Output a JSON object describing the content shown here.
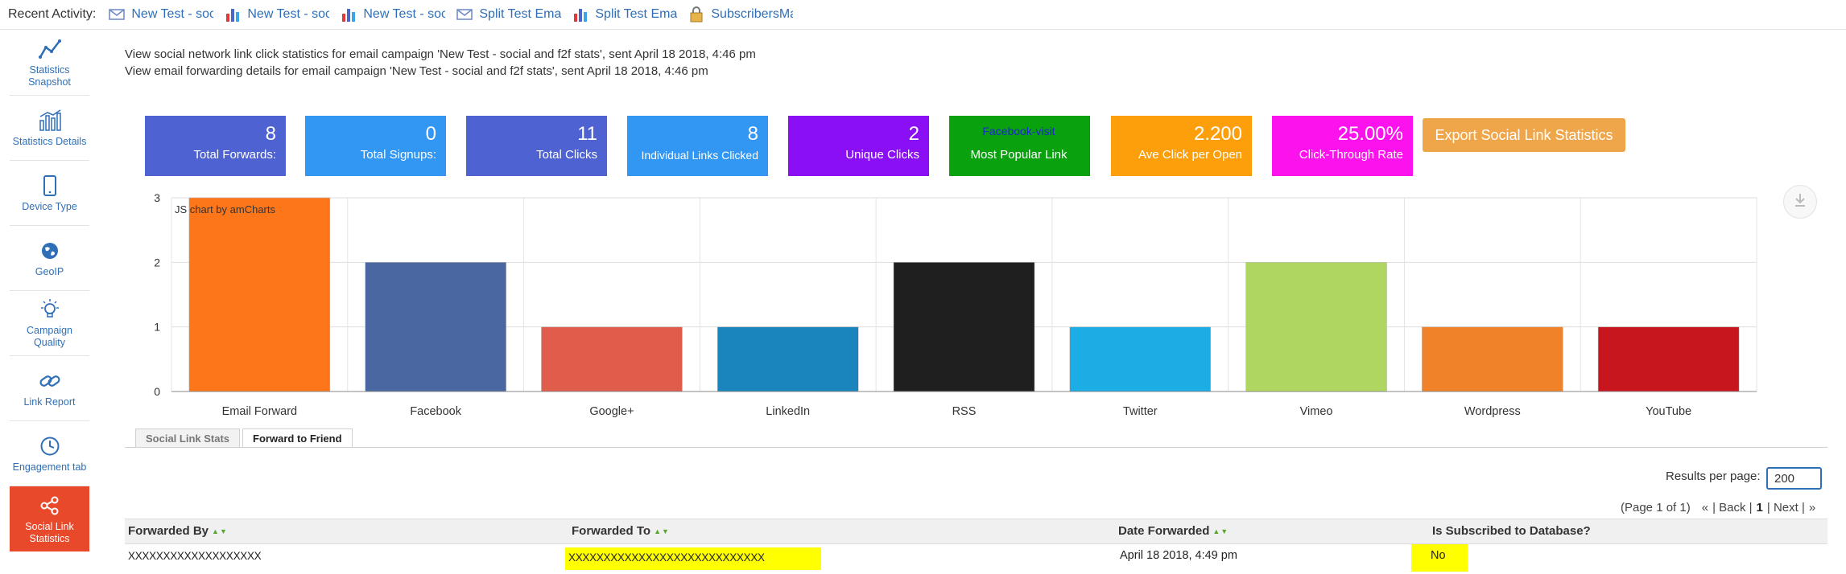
{
  "recent": {
    "label": "Recent Activity:",
    "items": [
      {
        "text": "New Test - soc",
        "icon": "envelope-icon"
      },
      {
        "text": "New Test - soc",
        "icon": "bar-chart-icon"
      },
      {
        "text": "New Test - soc",
        "icon": "bar-chart-icon"
      },
      {
        "text": "Split Test Emai",
        "icon": "envelope-icon"
      },
      {
        "text": "Split Test Emai",
        "icon": "bar-chart-icon"
      },
      {
        "text": "SubscribersMa",
        "icon": "lock-icon"
      }
    ]
  },
  "sidebar": {
    "items": [
      {
        "label": "Statistics Snapshot",
        "icon": "line-chart-icon",
        "active": false
      },
      {
        "label": "Statistics Details",
        "icon": "bar-chart-detail-icon",
        "active": false
      },
      {
        "label": "Device Type",
        "icon": "mobile-icon",
        "active": false
      },
      {
        "label": "GeoIP",
        "icon": "globe-icon",
        "active": false
      },
      {
        "label": "Campaign Quality",
        "icon": "lightbulb-icon",
        "active": false
      },
      {
        "label": "Link Report",
        "icon": "link-icon",
        "active": false
      },
      {
        "label": "Engagement tab",
        "icon": "clock-icon",
        "active": false
      },
      {
        "label": "Social Link Statistics",
        "icon": "share-icon",
        "active": true
      }
    ]
  },
  "info": {
    "line1": "View social network link click statistics for email campaign 'New Test - social and f2f stats', sent April 18 2018, 4:46 pm",
    "line2": "View email forwarding details for email campaign 'New Test - social and f2f stats', sent April 18 2018, 4:46 pm"
  },
  "tiles": [
    {
      "value": "8",
      "label": "Total Forwards:",
      "color": "#4e62d2"
    },
    {
      "value": "0",
      "label": "Total Signups:",
      "color": "#3296f3"
    },
    {
      "value": "11",
      "label": "Total Clicks",
      "color": "#4e62d2"
    },
    {
      "value": "8",
      "label": "Individual Links Clicked",
      "color": "#3296f3"
    },
    {
      "value": "2",
      "label": "Unique Clicks",
      "color": "#8b0ff5"
    },
    {
      "value": "Facebook-visit",
      "label": "Most Popular Link",
      "color": "#0aa10f"
    },
    {
      "value": "2.200",
      "label": "Ave Click per Open",
      "color": "#fd9f0a"
    },
    {
      "value": "25.00%",
      "label": "Click-Through Rate",
      "color": "#fb12ec"
    }
  ],
  "export_button": "Export Social Link Statistics",
  "chart_data": {
    "type": "bar",
    "categories": [
      "Email Forward",
      "Facebook",
      "Google+",
      "LinkedIn",
      "RSS",
      "Twitter",
      "Vimeo",
      "Wordpress",
      "YouTube"
    ],
    "values": [
      3,
      2,
      1,
      1,
      2,
      1,
      2,
      1,
      1
    ],
    "colors": [
      "#fd7619",
      "#4a67a1",
      "#e05d4c",
      "#1a84bd",
      "#1f1f1f",
      "#1cade4",
      "#aed661",
      "#f0832a",
      "#c8161e"
    ],
    "ylim": [
      0,
      3
    ],
    "yticks": [
      0,
      1,
      2,
      3
    ],
    "grid": true,
    "credit": "JS chart by amCharts"
  },
  "tabs": [
    {
      "label": "Social Link Stats",
      "active": false
    },
    {
      "label": "Forward to Friend",
      "active": true
    }
  ],
  "results": {
    "label": "Results per page:",
    "value": "200"
  },
  "pager": {
    "page_info": "(Page 1 of 1)",
    "first": "«",
    "prev": "| Back |",
    "current": "1",
    "next": "| Next |",
    "last": "»"
  },
  "table": {
    "columns": [
      "Forwarded By",
      "Forwarded To",
      "Date Forwarded",
      "Is Subscribed to Database?"
    ],
    "rows": [
      {
        "by": "XXXXXXXXXXXXXXXXXXX",
        "to": "XXXXXXXXXXXXXXXXXXXXXXXXXXXX",
        "date": "April 18 2018, 4:49 pm",
        "subscribed": "No"
      }
    ]
  }
}
